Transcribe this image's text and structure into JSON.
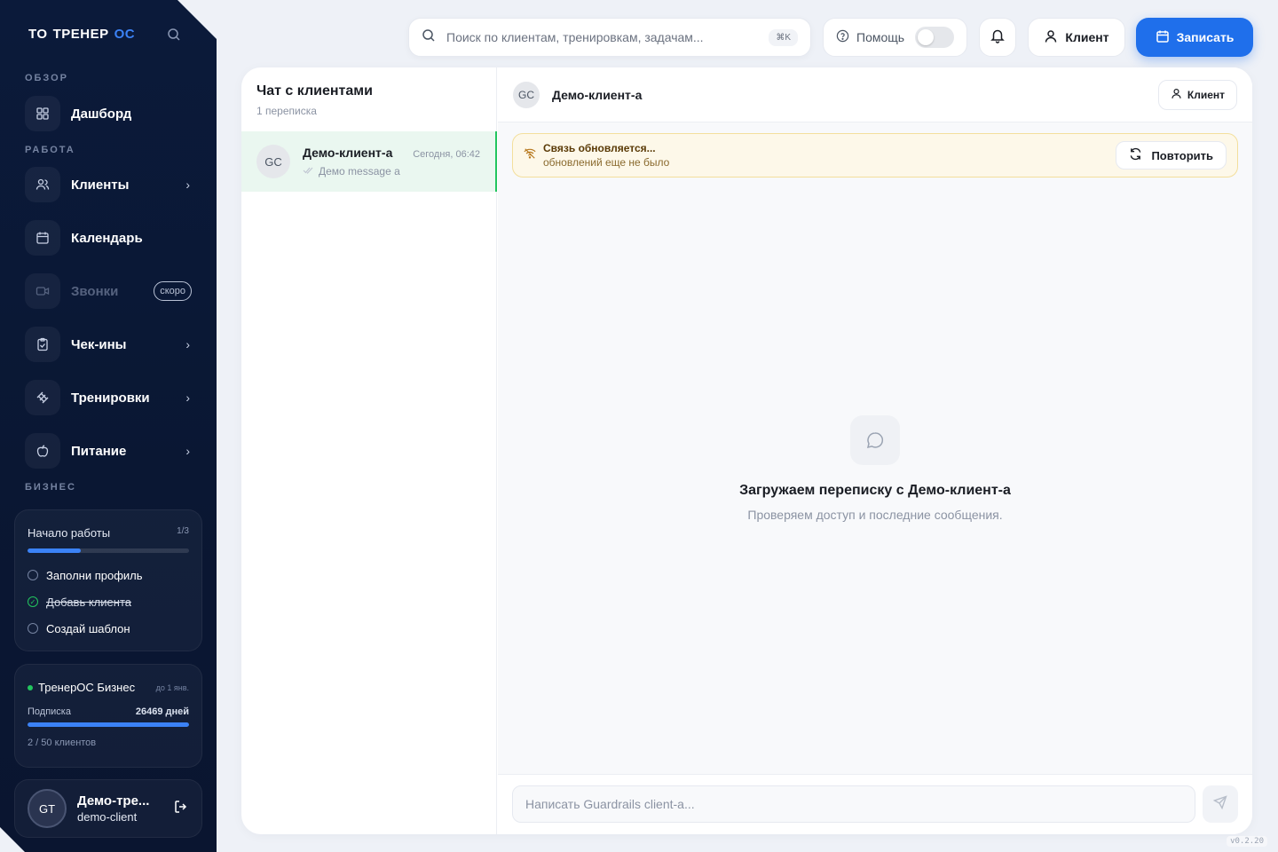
{
  "brand": {
    "logo_mark": "TO",
    "name": "ТРЕНЕР",
    "suffix": "OC"
  },
  "sidebar": {
    "sections": {
      "overview": "ОБЗОР",
      "work": "РАБОТА",
      "business": "БИЗНЕС"
    },
    "items": [
      {
        "label": "Дашборд",
        "icon": "dashboard-icon"
      },
      {
        "label": "Клиенты",
        "icon": "users-icon"
      },
      {
        "label": "Календарь",
        "icon": "calendar-icon"
      },
      {
        "label": "Звонки",
        "icon": "video-icon",
        "badge": "скоро"
      },
      {
        "label": "Чек-ины",
        "icon": "clipboard-icon"
      },
      {
        "label": "Тренировки",
        "icon": "dumbbell-icon"
      },
      {
        "label": "Питание",
        "icon": "apple-icon"
      }
    ],
    "onboarding": {
      "title": "Начало работы",
      "count": "1/3",
      "progress": 0.33,
      "tasks": [
        {
          "label": "Заполни профиль",
          "done": false
        },
        {
          "label": "Добавь клиента",
          "done": true
        },
        {
          "label": "Создай шаблон",
          "done": false
        }
      ]
    },
    "plan": {
      "name": "ТренерОС Бизнес",
      "until": "до 1 янв.",
      "subscription_label": "Подписка",
      "days": "26469 дней",
      "progress": 1.0,
      "clients": "2 / 50 клиентов"
    },
    "user": {
      "initials": "GT",
      "name": "Демо-тре...",
      "login": "demo-client"
    }
  },
  "topbar": {
    "search_placeholder": "Поиск по клиентам, тренировкам, задачам...",
    "shortcut": "⌘K",
    "help_label": "Помощь",
    "client_label": "Клиент",
    "record_label": "Записать"
  },
  "chat_list": {
    "title": "Чат с клиентами",
    "subtitle": "1 переписка",
    "items": [
      {
        "initials": "GC",
        "name": "Демо-клиент-а",
        "time": "Сегодня, 06:42",
        "preview": "Демо message a"
      }
    ]
  },
  "chat": {
    "initials": "GC",
    "name": "Демо-клиент-а",
    "client_button": "Клиент",
    "alert_title": "Связь обновляется...",
    "alert_subtitle": "обновлений еще не было",
    "retry_label": "Повторить",
    "loading_title": "Загружаем переписку с Демо-клиент-а",
    "loading_subtitle": "Проверяем доступ и последние сообщения.",
    "composer_placeholder": "Написать Guardrails client-a..."
  },
  "version": "v0.2.20",
  "colors": {
    "accent": "#1f6feb",
    "sidebar": "#0b1a3a",
    "success": "#22c55e",
    "warning_bg": "#fdf8e9"
  }
}
